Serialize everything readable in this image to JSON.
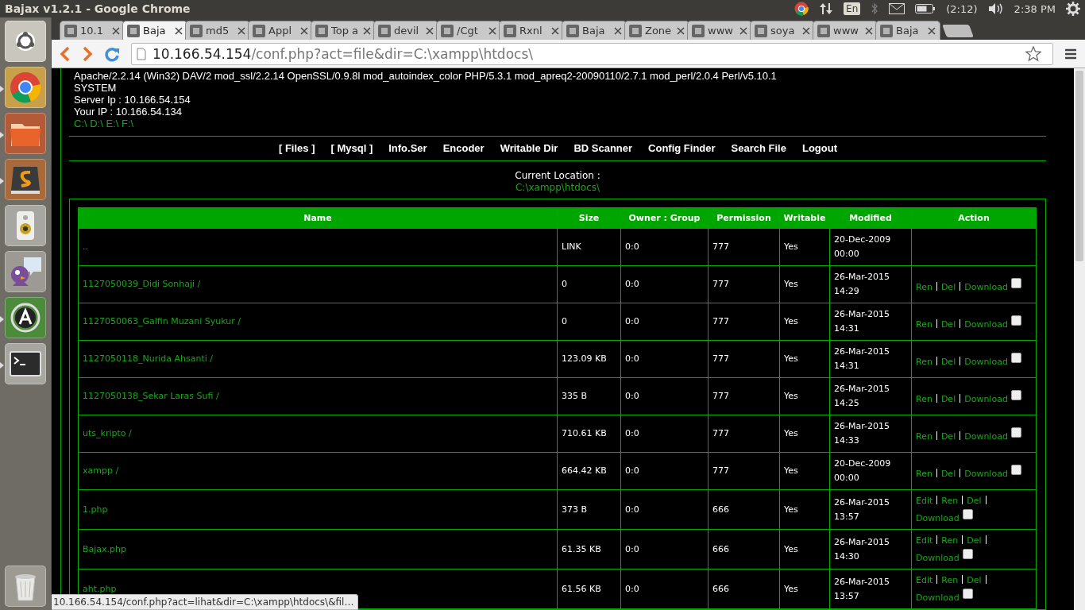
{
  "top_panel": {
    "title": "Bajax v1.2.1 - Google Chrome",
    "keyboard": "En",
    "battery": "(2:12)",
    "clock": "2:38 PM"
  },
  "launcher": [
    {
      "kind": "ubuntu",
      "running": false
    },
    {
      "kind": "chrome",
      "running": true
    },
    {
      "kind": "folder",
      "running": true
    },
    {
      "kind": "editor",
      "running": true
    },
    {
      "kind": "speaker",
      "running": false
    },
    {
      "kind": "chat",
      "running": false
    },
    {
      "kind": "update",
      "running": true
    },
    {
      "kind": "terminal",
      "running": true
    },
    {
      "kind": "trash",
      "running": false
    }
  ],
  "tabs": [
    {
      "title": "10.1",
      "selected": false
    },
    {
      "title": "Baja",
      "selected": true
    },
    {
      "title": "md5",
      "selected": false
    },
    {
      "title": "Appl",
      "selected": false
    },
    {
      "title": "Top a",
      "selected": false
    },
    {
      "title": "devil",
      "selected": false
    },
    {
      "title": "/Cgt",
      "selected": false
    },
    {
      "title": "Rxnl",
      "selected": false
    },
    {
      "title": "Baja",
      "selected": false
    },
    {
      "title": "Zone",
      "selected": false
    },
    {
      "title": "www",
      "selected": false
    },
    {
      "title": "soya",
      "selected": false
    },
    {
      "title": "www",
      "selected": false
    },
    {
      "title": "Baja",
      "selected": false
    }
  ],
  "address_bar": {
    "host": "10.166.54.154",
    "path": "/conf.php?act=file&dir=C:\\xampp\\htdocs\\"
  },
  "server_info": [
    "Apache/2.2.14 (Win32) DAV/2 mod_ssl/2.2.14 OpenSSL/0.9.8l mod_autoindex_color PHP/5.3.1 mod_apreq2-20090110/2.7.1 mod_perl/2.0.4 Perl/v5.10.1",
    "SYSTEM",
    "Server Ip : 10.166.54.154",
    "Your IP : 10.166.54.134"
  ],
  "drives": "C:\\ D:\\ E:\\ F:\\",
  "nav": [
    "[ Files ]",
    "[ Mysql ]",
    "Info.Ser",
    "Encoder",
    "Writable Dir",
    "BD Scanner",
    "Config Finder",
    "Search File",
    "Logout"
  ],
  "location": {
    "label": "Current Location :",
    "path": "C:\\xampp\\htdocs\\"
  },
  "table": {
    "columns": [
      "Name",
      "Size",
      "Owner : Group",
      "Permission",
      "Writable",
      "Modified",
      "Action"
    ],
    "rows": [
      {
        "name": "..",
        "size": "LINK",
        "owner": "0:0",
        "permission": "777",
        "writable": "Yes",
        "modified": [
          "20-Dec-2009",
          "00:00"
        ],
        "actions": []
      },
      {
        "name": "1127050039_Didi Sonhaji /",
        "size": "0",
        "owner": "0:0",
        "permission": "777",
        "writable": "Yes",
        "modified": [
          "26-Mar-2015",
          "14:29"
        ],
        "actions": [
          "Ren",
          "Del",
          "Download"
        ],
        "checked": false
      },
      {
        "name": "1127050063_Galfin Muzani Syukur /",
        "size": "0",
        "owner": "0:0",
        "permission": "777",
        "writable": "Yes",
        "modified": [
          "26-Mar-2015",
          "14:31"
        ],
        "actions": [
          "Ren",
          "Del",
          "Download"
        ],
        "checked": false
      },
      {
        "name": "1127050118_Nurida Ahsanti /",
        "size": "123.09 KB",
        "owner": "0:0",
        "permission": "777",
        "writable": "Yes",
        "modified": [
          "26-Mar-2015",
          "14:31"
        ],
        "actions": [
          "Ren",
          "Del",
          "Download"
        ],
        "checked": false
      },
      {
        "name": "1127050138_Sekar Laras Sufi /",
        "size": "335 B",
        "owner": "0:0",
        "permission": "777",
        "writable": "Yes",
        "modified": [
          "26-Mar-2015",
          "14:25"
        ],
        "actions": [
          "Ren",
          "Del",
          "Download"
        ],
        "checked": false
      },
      {
        "name": "uts_kripto /",
        "size": "710.61 KB",
        "owner": "0:0",
        "permission": "777",
        "writable": "Yes",
        "modified": [
          "26-Mar-2015",
          "14:33"
        ],
        "actions": [
          "Ren",
          "Del",
          "Download"
        ],
        "checked": false
      },
      {
        "name": "xampp /",
        "size": "664.42 KB",
        "owner": "0:0",
        "permission": "777",
        "writable": "Yes",
        "modified": [
          "20-Dec-2009",
          "00:00"
        ],
        "actions": [
          "Ren",
          "Del",
          "Download"
        ],
        "checked": false
      },
      {
        "name": "1.php",
        "size": "373 B",
        "owner": "0:0",
        "permission": "666",
        "writable": "Yes",
        "modified": [
          "26-Mar-2015",
          "13:57"
        ],
        "actions": [
          "Edit",
          "Ren",
          "Del",
          "Download"
        ],
        "checked": false
      },
      {
        "name": "Bajax.php",
        "size": "61.35 KB",
        "owner": "0:0",
        "permission": "666",
        "writable": "Yes",
        "modified": [
          "26-Mar-2015",
          "14:30"
        ],
        "actions": [
          "Edit",
          "Ren",
          "Del",
          "Download"
        ],
        "checked": false
      },
      {
        "name": "aht.php",
        "size": "61.56 KB",
        "owner": "0:0",
        "permission": "666",
        "writable": "Yes",
        "modified": [
          "26-Mar-2015",
          "13:57"
        ],
        "actions": [
          "Edit",
          "Ren",
          "Del",
          "Download"
        ],
        "checked": false
      }
    ]
  },
  "status_bubble": "10.166.54.154/conf.php?act=lihat&dir=C:\\xampp\\htdocs\\&fil…"
}
